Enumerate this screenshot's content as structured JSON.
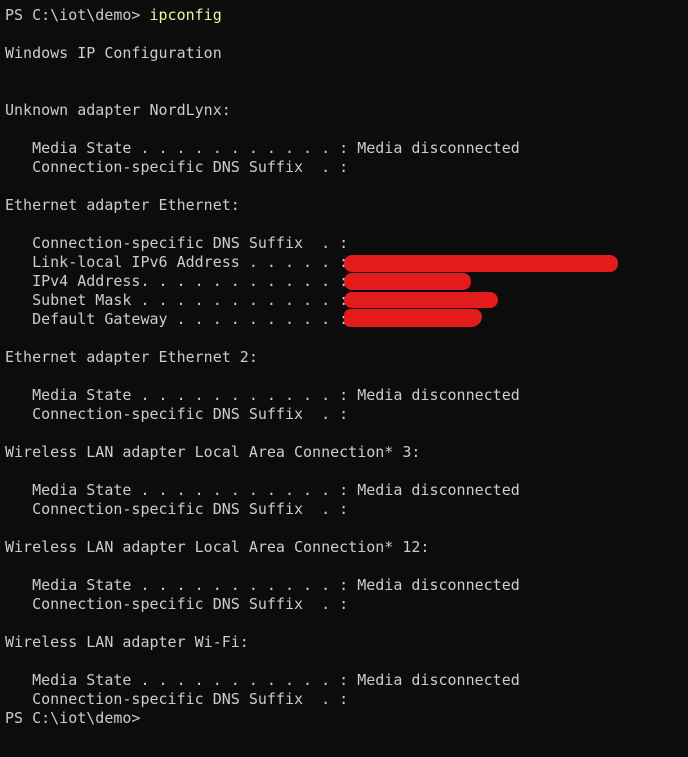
{
  "terminal": {
    "prompt": "PS C:\\iot\\demo> ",
    "command": "ipconfig",
    "title": "Windows IP Configuration",
    "sections": [
      {
        "header": "Unknown adapter NordLynx:",
        "lines": [
          "   Media State . . . . . . . . . . . : Media disconnected",
          "   Connection-specific DNS Suffix  . :"
        ]
      },
      {
        "header": "Ethernet adapter Ethernet:",
        "lines": [
          "   Connection-specific DNS Suffix  . :",
          "   Link-local IPv6 Address . . . . . :",
          "   IPv4 Address. . . . . . . . . . . :",
          "   Subnet Mask . . . . . . . . . . . :",
          "   Default Gateway . . . . . . . . . :"
        ]
      },
      {
        "header": "Ethernet adapter Ethernet 2:",
        "lines": [
          "   Media State . . . . . . . . . . . : Media disconnected",
          "   Connection-specific DNS Suffix  . :"
        ]
      },
      {
        "header": "Wireless LAN adapter Local Area Connection* 3:",
        "lines": [
          "   Media State . . . . . . . . . . . : Media disconnected",
          "   Connection-specific DNS Suffix  . :"
        ]
      },
      {
        "header": "Wireless LAN adapter Local Area Connection* 12:",
        "lines": [
          "   Media State . . . . . . . . . . . : Media disconnected",
          "   Connection-specific DNS Suffix  . :"
        ]
      },
      {
        "header": "Wireless LAN adapter Wi-Fi:",
        "lines": [
          "   Media State . . . . . . . . . . . : Media disconnected",
          "   Connection-specific DNS Suffix  . :"
        ]
      }
    ],
    "final_prompt": "PS C:\\iot\\demo>"
  },
  "colors": {
    "background": "#0c0c0c",
    "text": "#cccccc",
    "command": "#f9f1a5",
    "redaction": "#e31b1b"
  }
}
